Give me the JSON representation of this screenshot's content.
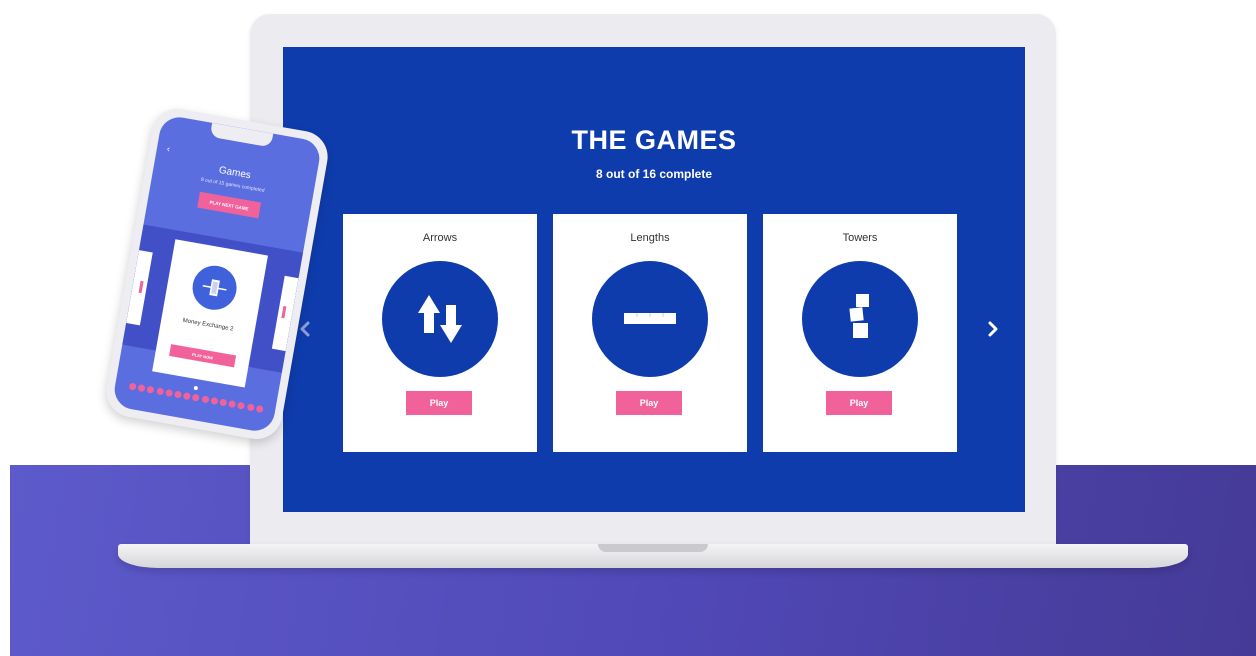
{
  "laptop": {
    "title": "THE GAMES",
    "subtitle": "8 out of 16 complete",
    "games": [
      {
        "name": "Arrows",
        "icon": "arrows-up-down-icon",
        "button": "Play"
      },
      {
        "name": "Lengths",
        "icon": "ruler-bar-icon",
        "button": "Play"
      },
      {
        "name": "Towers",
        "icon": "stacked-blocks-icon",
        "button": "Play"
      }
    ],
    "prev_icon": "chevron-left-icon",
    "next_icon": "chevron-right-icon"
  },
  "phone": {
    "back_glyph": "‹",
    "title": "Games",
    "subtitle": "8 out of 15 games completed",
    "next_button": "PLAY NEXT GAME",
    "card_name": "Money Exchange 2",
    "card_button": "PLAY NOW"
  },
  "colors": {
    "screen_blue": "#0f3cad",
    "accent_pink": "#f2629a",
    "phone_blue": "#5b6ee0",
    "floor_purple": "#5048b6"
  }
}
